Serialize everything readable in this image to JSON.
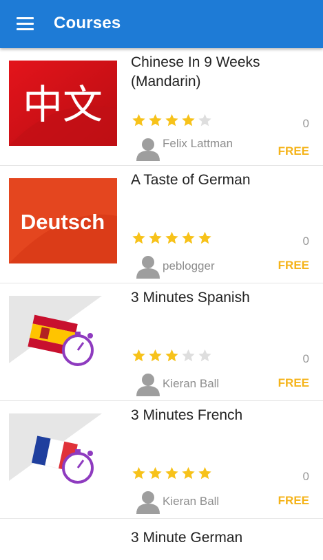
{
  "appbar": {
    "title": "Courses",
    "menu_icon": "hamburger-menu-icon"
  },
  "colors": {
    "primary": "#1e7bd6",
    "star_on": "#f7c21a",
    "star_off": "#dedede",
    "price": "#f5b319"
  },
  "courses": [
    {
      "title": "Chinese In 9 Weeks (Mandarin)",
      "rating": 4,
      "rating_count": "0",
      "author": "Felix Lattman",
      "price": "FREE",
      "thumb_text": "中文"
    },
    {
      "title": "A Taste of German",
      "rating": 5,
      "rating_count": "0",
      "author": "peblogger",
      "price": "FREE",
      "thumb_text": "Deutsch"
    },
    {
      "title": "3 Minutes Spanish",
      "rating": 3,
      "rating_count": "0",
      "author": "Kieran Ball",
      "price": "FREE"
    },
    {
      "title": "3 Minutes French",
      "rating": 5,
      "rating_count": "0",
      "author": "Kieran Ball",
      "price": "FREE"
    },
    {
      "title": "3 Minute German"
    }
  ]
}
